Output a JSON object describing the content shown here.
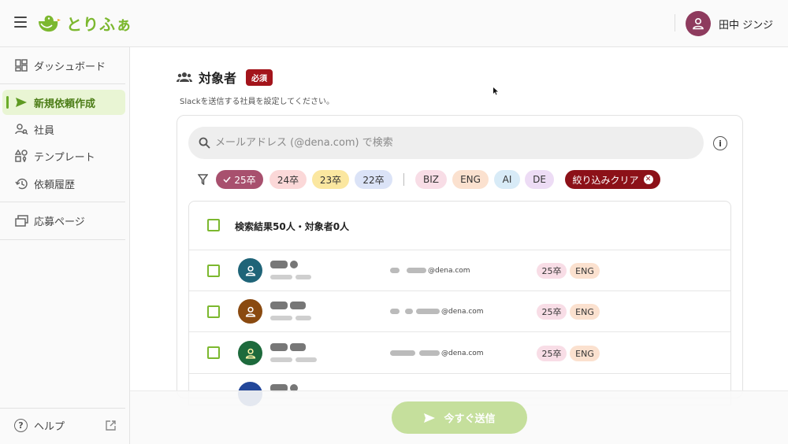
{
  "header": {
    "app_name": "とりふぁ",
    "user_name": "田中 ジンジ",
    "brand_color": "#7cb82f",
    "avatar_color": "#8e3b5e"
  },
  "sidebar": {
    "items": [
      {
        "label": "ダッシュボード",
        "icon": "dashboard-icon"
      },
      {
        "label": "新規依頼作成",
        "icon": "send-icon",
        "active": true
      },
      {
        "label": "社員",
        "icon": "people-search-icon"
      },
      {
        "label": "テンプレート",
        "icon": "template-icon"
      },
      {
        "label": "依頼履歴",
        "icon": "history-icon"
      },
      {
        "label": "応募ページ",
        "icon": "pages-icon"
      }
    ],
    "help_label": "ヘルプ"
  },
  "section": {
    "title": "対象者",
    "required_badge": "必須",
    "description": "Slackを送信する社員を設定してください。"
  },
  "search": {
    "placeholder": "メールアドレス (@dena.com) で検索",
    "value": ""
  },
  "filters": {
    "year_chips": [
      {
        "label": "25卒",
        "selected": true,
        "color": "#a8506e"
      },
      {
        "label": "24卒",
        "selected": false,
        "color": "#fbd8d8"
      },
      {
        "label": "23卒",
        "selected": false,
        "color": "#fbe7a0"
      },
      {
        "label": "22卒",
        "selected": false,
        "color": "#dbe3f7"
      }
    ],
    "dept_chips": [
      {
        "label": "BIZ",
        "color": "#f8dde6"
      },
      {
        "label": "ENG",
        "color": "#fbe1cf"
      },
      {
        "label": "AI",
        "color": "#d8ebf7"
      },
      {
        "label": "DE",
        "color": "#eddcf5"
      }
    ],
    "clear_label": "絞り込みクリア"
  },
  "results": {
    "header": "検索結果50人・対象者0人",
    "rows": [
      {
        "avatar_color": "#1f6478",
        "email_domain": "@dena.com",
        "tags": [
          "25卒",
          "ENG"
        ]
      },
      {
        "avatar_color": "#8a4a10",
        "email_domain": "@dena.com",
        "tags": [
          "25卒",
          "ENG"
        ]
      },
      {
        "avatar_color": "#1d6a3c",
        "email_domain": "@dena.com",
        "tags": [
          "25卒",
          "ENG"
        ]
      }
    ]
  },
  "actions": {
    "send_label": "今すぐ送信"
  }
}
